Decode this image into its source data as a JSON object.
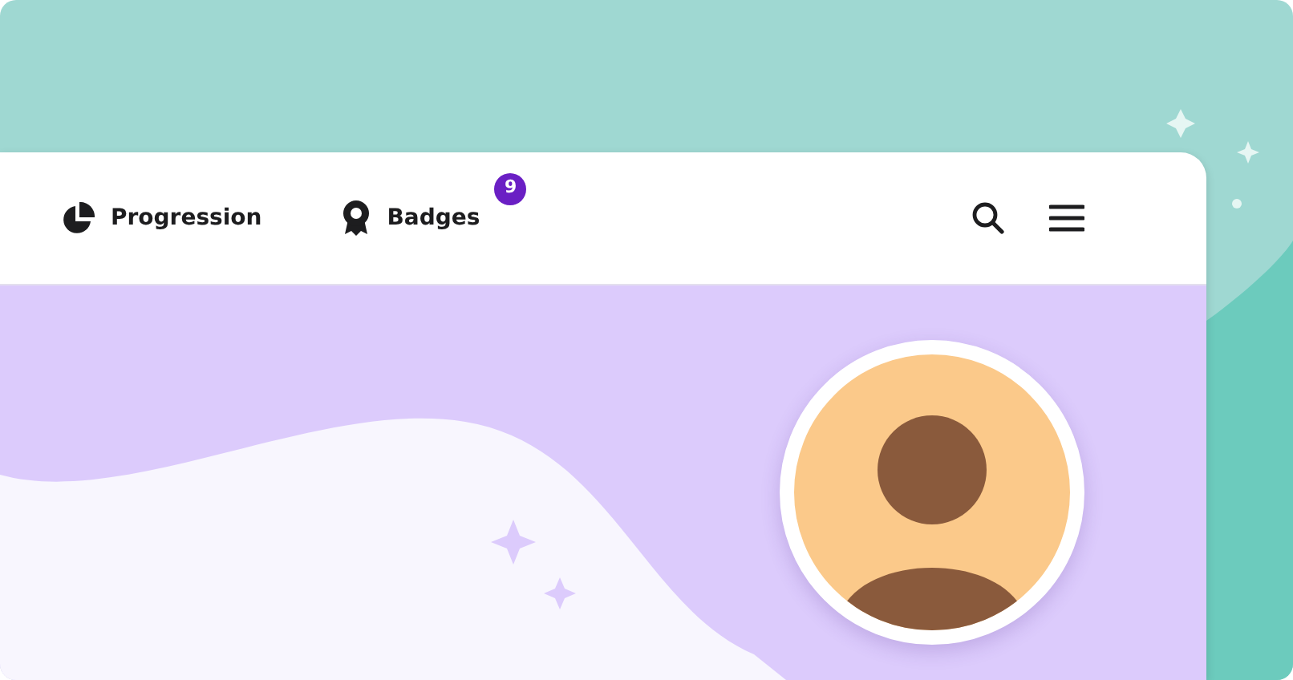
{
  "nav": {
    "items": [
      {
        "kind": "progression",
        "label": "Progression"
      },
      {
        "kind": "badges",
        "label": "Badges",
        "count": "9"
      }
    ]
  }
}
